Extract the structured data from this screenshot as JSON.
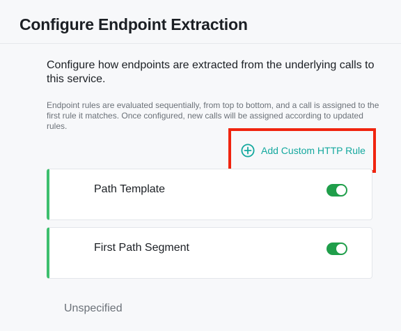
{
  "page": {
    "title": "Configure Endpoint Extraction"
  },
  "intro": {
    "text": "Configure how endpoints are extracted from the underlying calls to this service."
  },
  "help": {
    "text": "Endpoint rules are evaluated sequentially, from top to bottom, and a call is assigned to the first rule it matches. Once configured, new calls will be assigned according to updated rules."
  },
  "actions": {
    "add_rule_label": "Add Custom HTTP Rule",
    "add_rule_icon": "plus-circle-icon"
  },
  "rules": [
    {
      "name": "Path Template",
      "enabled": true
    },
    {
      "name": "First Path Segment",
      "enabled": true
    }
  ],
  "footer": {
    "unspecified_label": "Unspecified"
  },
  "colors": {
    "accent_teal": "#13a89e",
    "rule_border_green": "#3dbf6e",
    "toggle_green": "#1f9e4a",
    "highlight_red": "#f0240f"
  }
}
